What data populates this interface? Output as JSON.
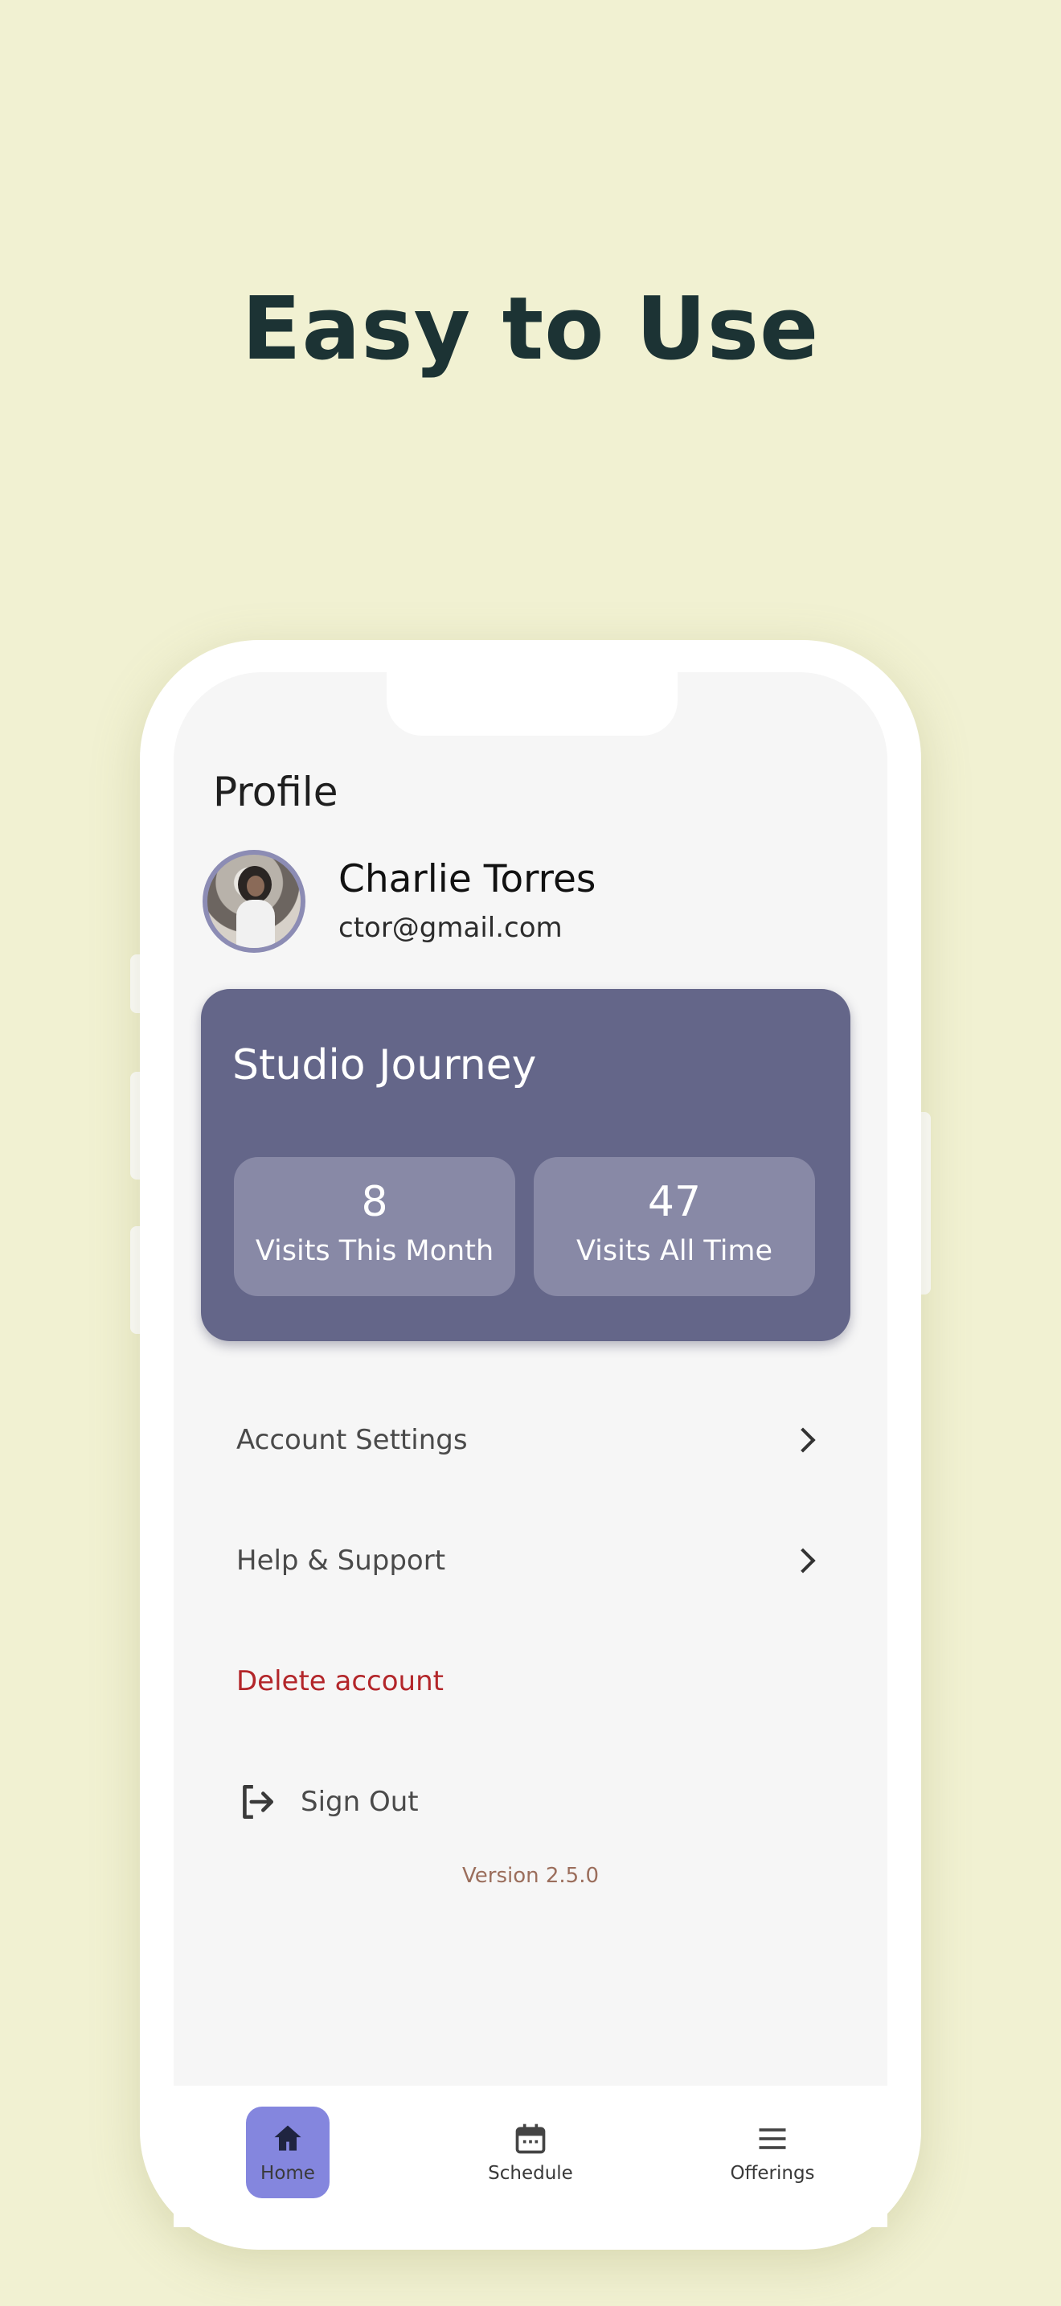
{
  "headline": "Easy to Use",
  "profile": {
    "title": "Profile",
    "name": "Charlie Torres",
    "email": "ctor@gmail.com"
  },
  "journey": {
    "title": "Studio Journey",
    "stats": [
      {
        "value": "8",
        "label": "Visits This Month"
      },
      {
        "value": "47",
        "label": "Visits All Time"
      }
    ]
  },
  "menu": {
    "account_settings": "Account Settings",
    "help_support": "Help & Support",
    "delete_account": "Delete account",
    "sign_out": "Sign Out"
  },
  "version": "Version 2.5.0",
  "nav": {
    "home": "Home",
    "schedule": "Schedule",
    "offerings": "Offerings"
  },
  "colors": {
    "background": "#f1f1d2",
    "card": "#646689",
    "active_tab": "#8486de",
    "danger": "#b3262a"
  }
}
